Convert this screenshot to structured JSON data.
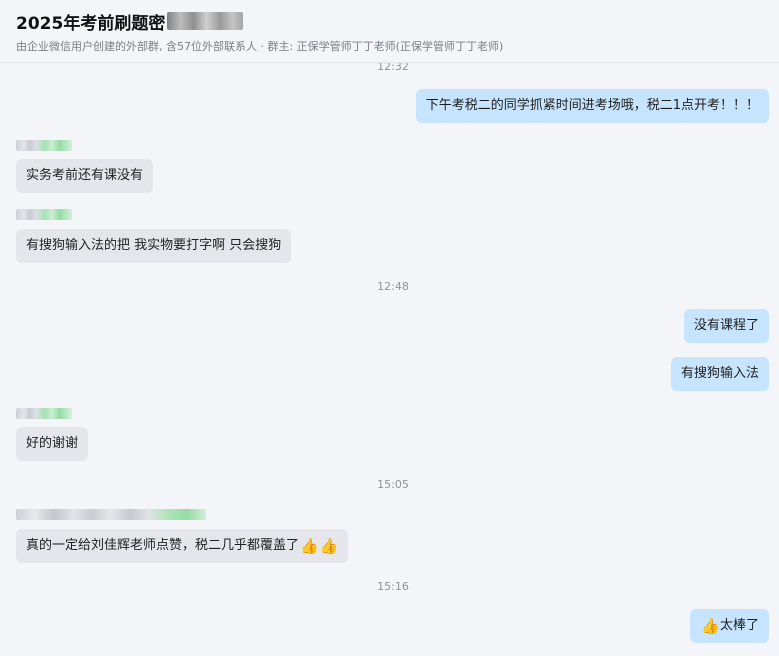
{
  "header": {
    "title": "2025年考前刷题密",
    "subtitle": "由企业微信用户创建的外部群, 含57位外部联系人 · 群主: 正保学管师丁丁老师(正保学管师丁丁老师)"
  },
  "messages": {
    "t1": "12:32",
    "m1": "下午考税二的同学抓紧时间进考场哦，税二1点开考！！！",
    "m2": "实务考前还有课没有",
    "m3": "有搜狗输入法的把 我实物要打字啊 只会搜狗",
    "t2": "12:48",
    "m4": "没有课程了",
    "m5": "有搜狗输入法",
    "m6": "好的谢谢",
    "t3": "15:05",
    "m7": "真的一定给刘佳辉老师点赞，税二几乎都覆盖了",
    "t4": "15:16",
    "m8": "太棒了"
  },
  "icons": {
    "thumbs_up": "thumbs-up-emoji"
  }
}
